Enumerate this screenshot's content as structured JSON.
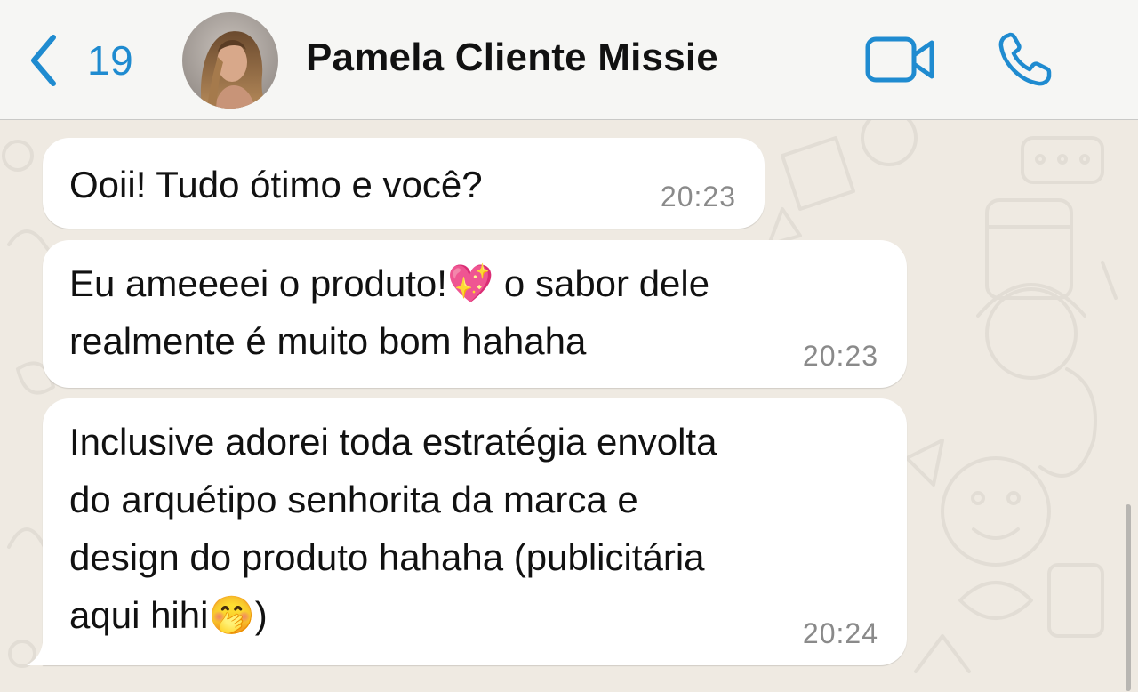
{
  "header": {
    "back_count": "19",
    "contact_name": "Pamela Cliente Missie"
  },
  "colors": {
    "accent": "#1f8bd0",
    "chat_background": "#efeae2",
    "bubble_background": "#ffffff",
    "timestamp": "#8a8a8a"
  },
  "icons": {
    "back": "chevron-left-icon",
    "video": "video-camera-icon",
    "phone": "phone-icon"
  },
  "messages": [
    {
      "text": "Ooii! Tudo ótimo e você?",
      "time": "20:23"
    },
    {
      "text_before_emoji": "Eu ameeeei o produto!",
      "emoji": "💖",
      "text_after_emoji": " o sabor dele\nrealmente é muito bom hahaha",
      "time": "20:23"
    },
    {
      "text_before_emoji": "Inclusive adorei toda estratégia envolta\ndo arquétipo senhorita da marca e\ndesign do produto hahaha (publicitária\naqui hihi",
      "emoji": "🤭",
      "text_after_emoji": ")",
      "time": "20:24"
    }
  ]
}
